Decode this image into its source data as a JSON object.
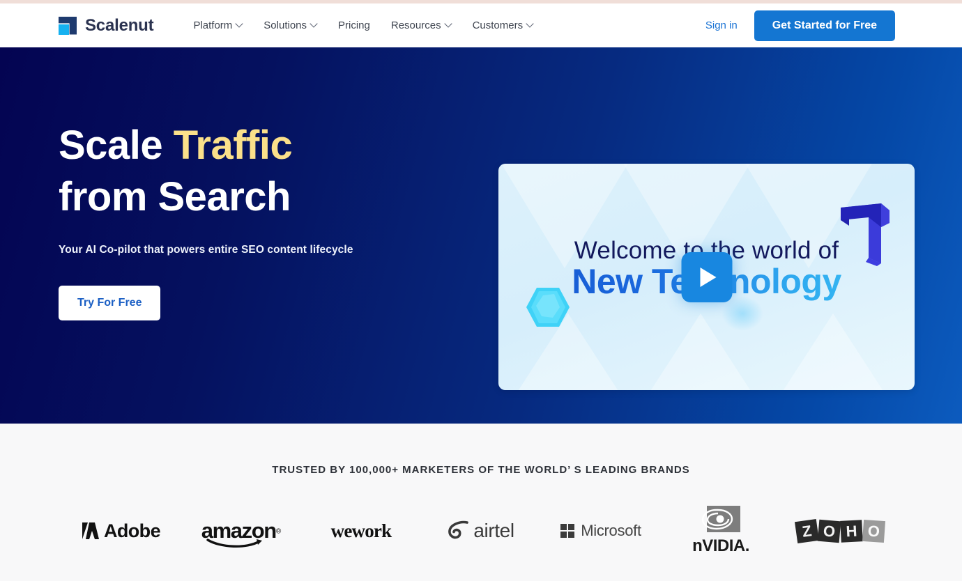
{
  "header": {
    "logo": {
      "name": "Scalenut",
      "icon": "scalenut-logo-icon"
    },
    "nav": [
      {
        "label": "Platform",
        "has_dropdown": true
      },
      {
        "label": "Solutions",
        "has_dropdown": true
      },
      {
        "label": "Pricing",
        "has_dropdown": false
      },
      {
        "label": "Resources",
        "has_dropdown": true
      },
      {
        "label": "Customers",
        "has_dropdown": true
      }
    ],
    "signin_label": "Sign in",
    "cta_label": "Get Started for Free",
    "cta_color": "#1476d2",
    "signin_color": "#1a73d4"
  },
  "hero": {
    "heading_line1_plain": "Scale ",
    "heading_line1_accent": "Traffic",
    "heading_line2": "from Search",
    "accent_color": "#fbe08a",
    "subtitle": "Your AI Co-pilot that powers entire SEO content lifecycle",
    "button_label": "Try For Free",
    "button_text_color": "#1b5fc4",
    "background_from": "#040452",
    "background_to": "#0c5bbe"
  },
  "video": {
    "line1": "Welcome to the world of",
    "line2": "New Technology",
    "line1_color": "#12185c",
    "line2_color": "#1a68dd",
    "card_background": "#ddf1fb",
    "play_button_color": "#1887e0",
    "play_icon": "play-triangle-icon",
    "decor_shape_icon": "3d-corner-shape-icon",
    "decor_gem_icon": "cyan-gem-icon"
  },
  "trusted": {
    "title": "TRUSTED BY 100,000+ MARKETERS OF THE WORLD’  S LEADING BRANDS",
    "background": "#f8f8f9",
    "logos": [
      {
        "name": "Adobe",
        "text": "Adobe"
      },
      {
        "name": "amazon",
        "text": "amazon"
      },
      {
        "name": "wework",
        "text": "wework"
      },
      {
        "name": "airtel",
        "text": "airtel"
      },
      {
        "name": "Microsoft",
        "text": "Microsoft"
      },
      {
        "name": "NVIDIA",
        "text": "nVIDIA."
      },
      {
        "name": "ZOHO",
        "text": "ZOHO"
      }
    ]
  }
}
